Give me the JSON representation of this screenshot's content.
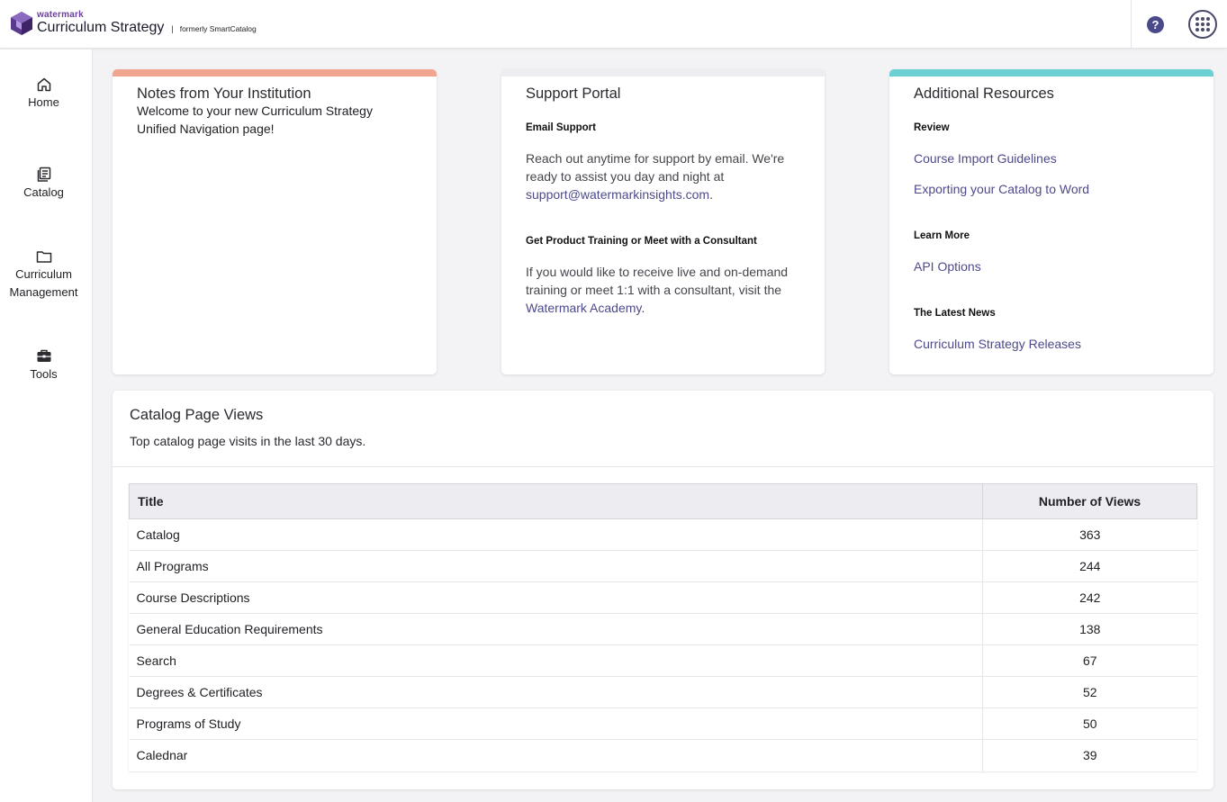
{
  "header": {
    "brand_small": "watermark",
    "brand_product": "Curriculum Strategy",
    "brand_separator": "|",
    "brand_formerly": "formerly SmartCatalog",
    "help_label": "?"
  },
  "sidebar": {
    "items": [
      {
        "label": "Home",
        "icon": "home-icon"
      },
      {
        "label": "Catalog",
        "icon": "book-icon"
      },
      {
        "label": "Curriculum Management",
        "icon": "folder-icon"
      },
      {
        "label": "Tools",
        "icon": "toolbox-icon"
      }
    ]
  },
  "notes": {
    "title": "Notes from Your Institution",
    "body": "Welcome to your new Curriculum Strategy Unified Navigation page!",
    "accent": "#f0a58e"
  },
  "support": {
    "title": "Support Portal",
    "accent": "#ececf1",
    "email_heading": "Email Support",
    "email_text": "Reach out anytime for support by email. We're ready to assist you day and night at",
    "email_link": "support@watermarkinsights.com",
    "email_after": ".",
    "training_heading": "Get Product Training or Meet with a Consultant",
    "training_text": "If you would like to receive live and on-demand training or meet 1:1 with a consultant, visit the",
    "training_link": "Watermark Academy",
    "training_after": "."
  },
  "resources": {
    "title": "Additional Resources",
    "accent": "#6ccfd2",
    "review_heading": "Review",
    "review_links": [
      "Course Import Guidelines",
      "Exporting your Catalog to Word"
    ],
    "learn_heading": "Learn More",
    "learn_links": [
      "API Options"
    ],
    "news_heading": "The Latest News",
    "news_links": [
      "Curriculum Strategy Releases"
    ]
  },
  "page_views": {
    "title": "Catalog Page Views",
    "description": "Top catalog page visits in the last 30 days.",
    "columns": [
      "Title",
      "Number of Views"
    ],
    "rows": [
      {
        "title": "Catalog",
        "views": "363"
      },
      {
        "title": "All Programs",
        "views": "244"
      },
      {
        "title": "Course Descriptions",
        "views": "242"
      },
      {
        "title": "General Education Requirements",
        "views": "138"
      },
      {
        "title": "Search",
        "views": "67"
      },
      {
        "title": "Degrees & Certificates",
        "views": "52"
      },
      {
        "title": "Programs of Study",
        "views": "50"
      },
      {
        "title": "Calednar",
        "views": "39"
      }
    ]
  }
}
